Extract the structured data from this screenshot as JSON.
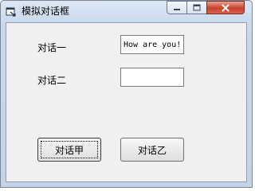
{
  "window": {
    "title": "模拟对话框",
    "icons": {
      "app": "dialog-app-icon",
      "minimize": "minimize-icon",
      "maximize": "maximize-icon",
      "close": "close-icon"
    }
  },
  "form": {
    "label1": "对话一",
    "label2": "对话二",
    "field1_value": "How are you!",
    "field2_value": ""
  },
  "buttons": {
    "btn1_label": "对话甲",
    "btn2_label": "对话乙"
  }
}
